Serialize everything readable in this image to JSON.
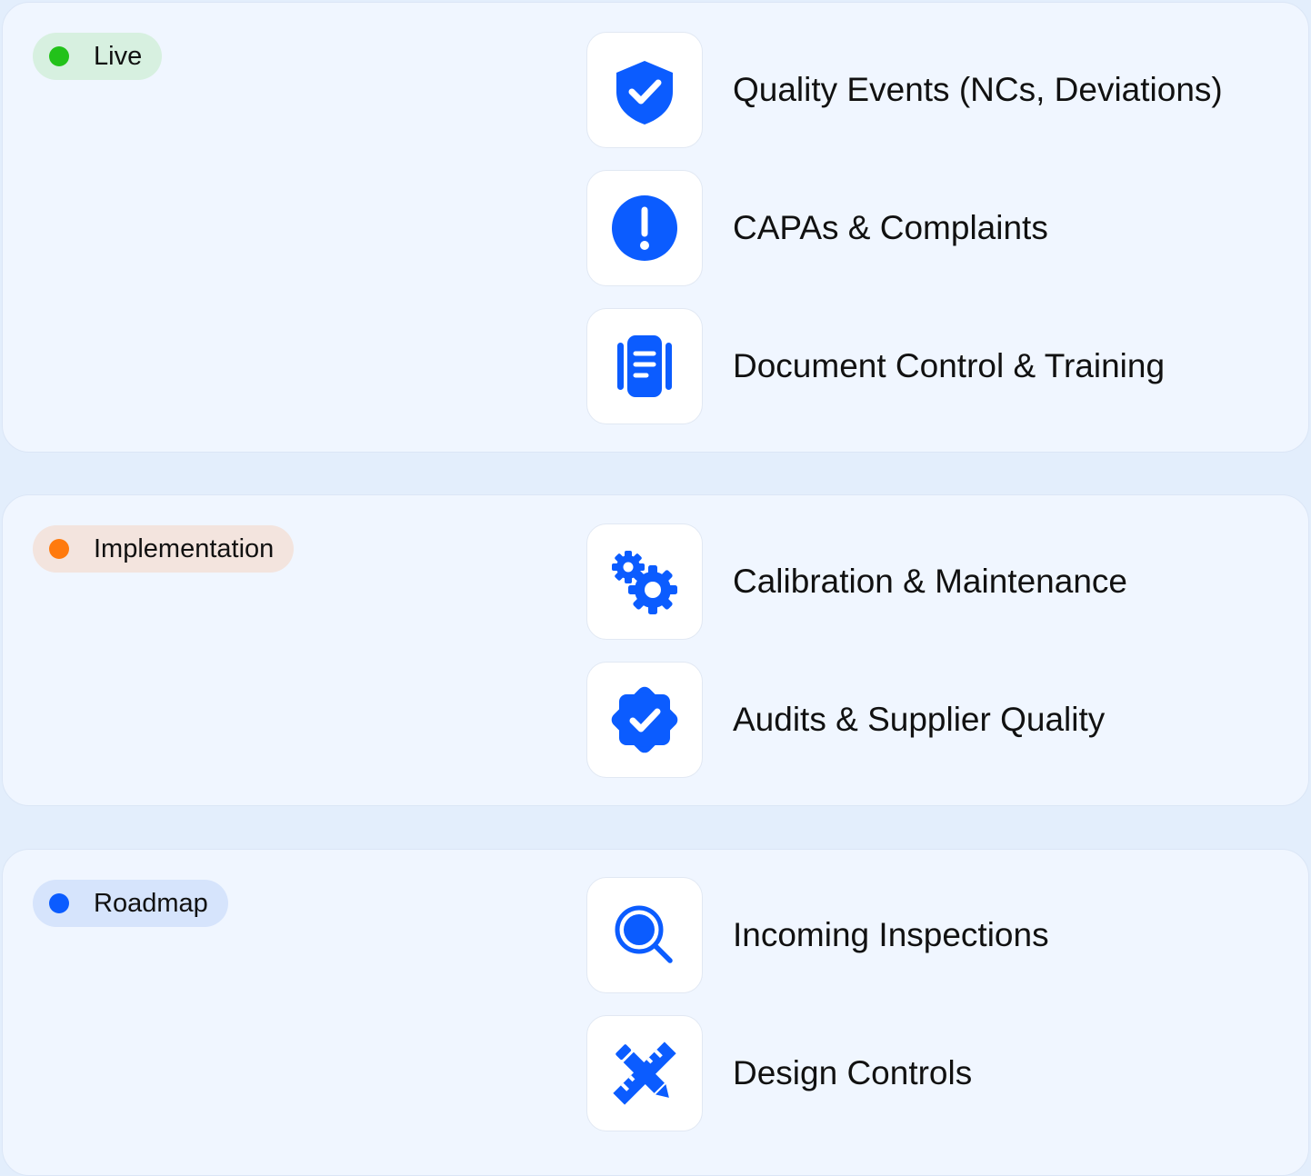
{
  "accent_color": "#0b5cff",
  "sections": [
    {
      "badge": {
        "label": "Live",
        "dot_color": "#22c21a",
        "bg_color": "#d7f0e0"
      },
      "items": [
        {
          "label": "Quality Events (NCs, Deviations)",
          "icon": "shield-check-icon"
        },
        {
          "label": "CAPAs & Complaints",
          "icon": "exclamation-circle-icon"
        },
        {
          "label": "Document Control & Training",
          "icon": "document-icon"
        }
      ]
    },
    {
      "badge": {
        "label": "Implementation",
        "dot_color": "#ff7a0d",
        "bg_color": "#f3e4de"
      },
      "items": [
        {
          "label": "Calibration & Maintenance",
          "icon": "gears-icon"
        },
        {
          "label": "Audits & Supplier Quality",
          "icon": "verified-badge-icon"
        }
      ]
    },
    {
      "badge": {
        "label": "Roadmap",
        "dot_color": "#0b5cff",
        "bg_color": "#d6e4fc"
      },
      "items": [
        {
          "label": "Incoming Inspections",
          "icon": "magnifier-icon"
        },
        {
          "label": "Design Controls",
          "icon": "pencil-ruler-icon"
        }
      ]
    }
  ]
}
